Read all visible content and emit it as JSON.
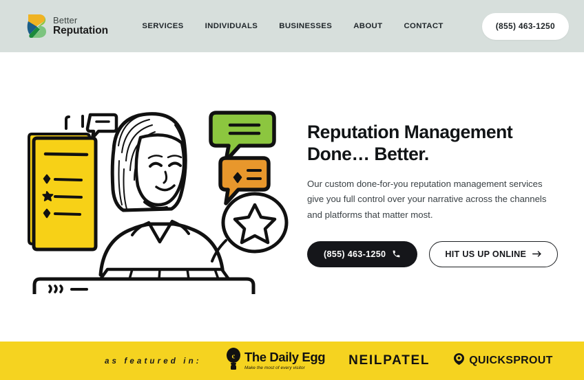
{
  "brand": {
    "line1": "Better",
    "line2": "Reputation",
    "mark_icon": "better-reputation-logo-icon",
    "colors": {
      "yellow": "#f0b323",
      "light_green": "#8cc63f",
      "dark_green": "#1a8a3c",
      "blue": "#1b5e88"
    }
  },
  "nav": {
    "items": [
      {
        "label": "SERVICES"
      },
      {
        "label": "INDIVIDUALS"
      },
      {
        "label": "BUSINESSES"
      },
      {
        "label": "ABOUT"
      },
      {
        "label": "CONTACT"
      }
    ],
    "phone_button": "(855) 463-1250"
  },
  "hero": {
    "headline_line1": "Reputation Management",
    "headline_line2": "Done… Better.",
    "subcopy": "Our custom done-for-you reputation management services give you full control over your narrative across the channels and platforms that matter most.",
    "cta_primary": "(855) 463-1250",
    "cta_primary_icon": "phone-icon",
    "cta_secondary": "HIT US UP ONLINE",
    "cta_secondary_icon": "arrow-right-icon",
    "illustration": {
      "name": "woman-with-reviews-illustration",
      "review_card_color": "#f7d117",
      "speech_bubble_green": "#8cc63f",
      "speech_bubble_orange": "#e8972c",
      "star_badge_icon": "star-in-circle-icon"
    }
  },
  "featured": {
    "label": "as featured in:",
    "background": "#f5d320",
    "logos": [
      {
        "name": "The Daily Egg",
        "tagline": "Make the most of every visitor",
        "icon": "daily-egg-balloon-icon"
      },
      {
        "name": "NEILPATEL",
        "icon": null
      },
      {
        "name": "QUICKSPROUT",
        "icon": "quicksprout-pin-icon"
      }
    ]
  },
  "theme": {
    "header_bg": "#d7dfdc",
    "page_bg": "#ffffff",
    "text_dark": "#111416",
    "cta_black": "#15161a"
  }
}
